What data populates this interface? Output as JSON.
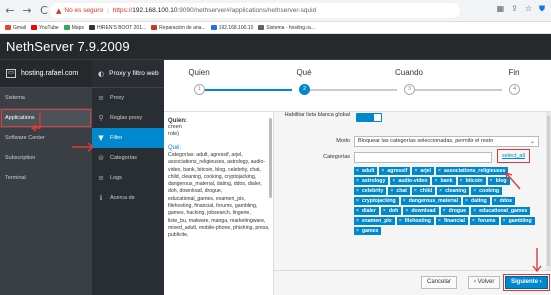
{
  "browser": {
    "back": "←",
    "forward": "→",
    "reload": "C",
    "insecure_label": "No es seguro",
    "url_scheme": "https://",
    "url_host": "192.168.100.10",
    "url_path": ":9090/nethserver#/applications/nethserver-squid",
    "icons": [
      "extension-icon",
      "share-icon",
      "star-icon",
      "shield-icon"
    ],
    "bookmarks": [
      {
        "label": "Gmail",
        "color": "#ea4335"
      },
      {
        "label": "YouTube",
        "color": "#ff0000"
      },
      {
        "label": "Maps",
        "color": "#34a853"
      },
      {
        "label": "HIREN'S BOOT 201...",
        "color": "#333333"
      },
      {
        "label": "Reparación de ana...",
        "color": "#d93025"
      },
      {
        "label": "192.168.100.10",
        "color": "#1a73e8"
      },
      {
        "label": "Sistema - hosting.ra...",
        "color": "#5f6368"
      }
    ]
  },
  "app": {
    "title": "NethServer 7.9.2009",
    "host": "hosting.rafael.com"
  },
  "left_nav": [
    {
      "label": "Sistema",
      "active": false
    },
    {
      "label": "Applications",
      "active": true
    },
    {
      "label": "Software Center",
      "active": false
    },
    {
      "label": "Subscription",
      "active": false
    },
    {
      "label": "Terminal",
      "active": false
    }
  ],
  "sub_nav": {
    "title": "Proxy y filtro web",
    "items": [
      {
        "label": "Proxy",
        "icon": "≡",
        "active": false
      },
      {
        "label": "Reglas proxy",
        "icon": "⚲",
        "active": false
      },
      {
        "label": "Filtro",
        "icon": "▼",
        "active": true
      },
      {
        "label": "Categorías",
        "icon": "⊘",
        "active": false
      },
      {
        "label": "Logs",
        "icon": "≡",
        "active": false
      },
      {
        "label": "Acerca de",
        "icon": "ℹ",
        "active": false
      }
    ]
  },
  "wizard": {
    "steps": [
      {
        "label": "Quien",
        "num": "1",
        "state": "done"
      },
      {
        "label": "Qué",
        "num": "2",
        "state": "active"
      },
      {
        "label": "Cuando",
        "num": "3",
        "state": "todo"
      },
      {
        "label": "Fin",
        "num": "4",
        "state": "todo"
      }
    ]
  },
  "help": {
    "quien_title": "Quien:",
    "quien_lines": [
      "creen",
      "role)"
    ],
    "que_title": "Qué:",
    "que_desc": "Categorías: adult, agressif, arjel, associations_religieuses, astrology, audio-video, bank, bitcoin, blog, celebrity, chat, child, cleaning, cooking, cryptojacking, dangerous_material, dating, ddos, dialer, doh, download, drogue, educational_games, examen_pix, filehosting, financial, forums, gambling, games, hacking, jobsearch, lingerie, liste_bu, malware, manga, marketingware, mixed_adult, mobile-phone, phishing, press, publicite,"
  },
  "form": {
    "whitelist_label": "Habilitar lista blanca global",
    "whitelist_enabled": true,
    "mode_label": "Modo",
    "mode_value": "Bloquear las categorías seleccionadas, permitir el resto",
    "categories_label": "Categorías",
    "select_all": "select_all",
    "tags": [
      "adult",
      "agressif",
      "arjel",
      "associations_religieuses",
      "astrology",
      "audio-video",
      "bank",
      "bitcoin",
      "blog",
      "celebrity",
      "chat",
      "child",
      "cleaning",
      "cooking",
      "cryptojacking",
      "dangerous_material",
      "dating",
      "ddos",
      "dialer",
      "doh",
      "download",
      "drogue",
      "educational_games",
      "examen_pix",
      "filehosting",
      "financial",
      "forums",
      "gambling",
      "games"
    ]
  },
  "footer": {
    "cancel": "Cancelar",
    "back": "‹ Volver",
    "next": "Siguiente ›"
  },
  "colors": {
    "accent": "#0088ce",
    "annotation": "#e03a3a",
    "header": "#26292c"
  }
}
